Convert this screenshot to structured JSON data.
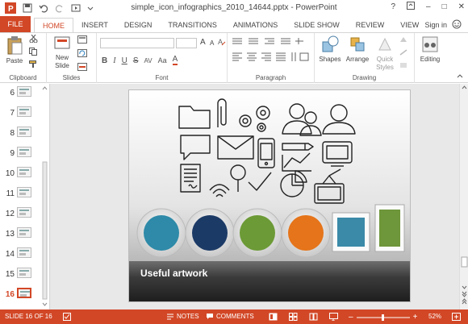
{
  "window": {
    "title": "simple_icon_infographics_2010_14644.pptx - PowerPoint",
    "help": "?",
    "minimize": "–",
    "restore": "□",
    "close": "✕"
  },
  "tabs": [
    "HOME",
    "INSERT",
    "DESIGN",
    "TRANSITIONS",
    "ANIMATIONS",
    "SLIDE SHOW",
    "REVIEW",
    "VIEW"
  ],
  "file_tab": "FILE",
  "sign_in": "Sign in",
  "ribbon": {
    "clipboard": {
      "label": "Clipboard",
      "paste": "Paste"
    },
    "slides": {
      "label": "Slides",
      "new_slide": "New",
      "new_slide2": "Slide"
    },
    "font": {
      "label": "Font",
      "size_up": "A",
      "size_down": "A",
      "bold": "B",
      "italic": "I",
      "underline": "U",
      "strike": "S",
      "spacing": "AV",
      "case": "Aa",
      "color": "A"
    },
    "paragraph": {
      "label": "Paragraph"
    },
    "drawing": {
      "label": "Drawing",
      "shapes": "Shapes",
      "arrange": "Arrange",
      "quick_styles": "Quick",
      "quick_styles2": "Styles"
    },
    "editing": {
      "label": "Editing"
    }
  },
  "thumbnails": [
    {
      "num": "6"
    },
    {
      "num": "7"
    },
    {
      "num": "8"
    },
    {
      "num": "9"
    },
    {
      "num": "10"
    },
    {
      "num": "11"
    },
    {
      "num": "12"
    },
    {
      "num": "13"
    },
    {
      "num": "14"
    },
    {
      "num": "15"
    },
    {
      "num": "16"
    }
  ],
  "slide": {
    "caption": "Useful artwork"
  },
  "status": {
    "slide_info": "SLIDE 16 OF 16",
    "notes": "NOTES",
    "comments": "COMMENTS",
    "zoom": "52%"
  },
  "colors": {
    "accent": "#d24726",
    "circle_teal": "#2e8aa8",
    "circle_navy": "#1c3a66",
    "circle_green": "#6c9a36",
    "circle_orange": "#e5741a",
    "square_teal": "#3a8aa8",
    "rect_green": "#6e963a"
  }
}
